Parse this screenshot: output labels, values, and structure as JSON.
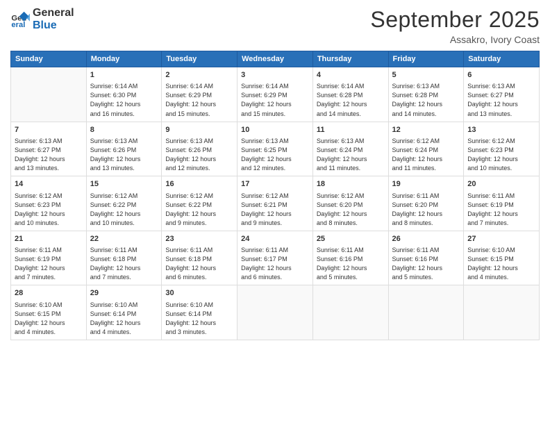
{
  "logo": {
    "line1": "General",
    "line2": "Blue"
  },
  "title": "September 2025",
  "location": "Assakro, Ivory Coast",
  "days_of_week": [
    "Sunday",
    "Monday",
    "Tuesday",
    "Wednesday",
    "Thursday",
    "Friday",
    "Saturday"
  ],
  "weeks": [
    [
      {
        "num": "",
        "info": ""
      },
      {
        "num": "1",
        "info": "Sunrise: 6:14 AM\nSunset: 6:30 PM\nDaylight: 12 hours\nand 16 minutes."
      },
      {
        "num": "2",
        "info": "Sunrise: 6:14 AM\nSunset: 6:29 PM\nDaylight: 12 hours\nand 15 minutes."
      },
      {
        "num": "3",
        "info": "Sunrise: 6:14 AM\nSunset: 6:29 PM\nDaylight: 12 hours\nand 15 minutes."
      },
      {
        "num": "4",
        "info": "Sunrise: 6:14 AM\nSunset: 6:28 PM\nDaylight: 12 hours\nand 14 minutes."
      },
      {
        "num": "5",
        "info": "Sunrise: 6:13 AM\nSunset: 6:28 PM\nDaylight: 12 hours\nand 14 minutes."
      },
      {
        "num": "6",
        "info": "Sunrise: 6:13 AM\nSunset: 6:27 PM\nDaylight: 12 hours\nand 13 minutes."
      }
    ],
    [
      {
        "num": "7",
        "info": "Sunrise: 6:13 AM\nSunset: 6:27 PM\nDaylight: 12 hours\nand 13 minutes."
      },
      {
        "num": "8",
        "info": "Sunrise: 6:13 AM\nSunset: 6:26 PM\nDaylight: 12 hours\nand 13 minutes."
      },
      {
        "num": "9",
        "info": "Sunrise: 6:13 AM\nSunset: 6:26 PM\nDaylight: 12 hours\nand 12 minutes."
      },
      {
        "num": "10",
        "info": "Sunrise: 6:13 AM\nSunset: 6:25 PM\nDaylight: 12 hours\nand 12 minutes."
      },
      {
        "num": "11",
        "info": "Sunrise: 6:13 AM\nSunset: 6:24 PM\nDaylight: 12 hours\nand 11 minutes."
      },
      {
        "num": "12",
        "info": "Sunrise: 6:12 AM\nSunset: 6:24 PM\nDaylight: 12 hours\nand 11 minutes."
      },
      {
        "num": "13",
        "info": "Sunrise: 6:12 AM\nSunset: 6:23 PM\nDaylight: 12 hours\nand 10 minutes."
      }
    ],
    [
      {
        "num": "14",
        "info": "Sunrise: 6:12 AM\nSunset: 6:23 PM\nDaylight: 12 hours\nand 10 minutes."
      },
      {
        "num": "15",
        "info": "Sunrise: 6:12 AM\nSunset: 6:22 PM\nDaylight: 12 hours\nand 10 minutes."
      },
      {
        "num": "16",
        "info": "Sunrise: 6:12 AM\nSunset: 6:22 PM\nDaylight: 12 hours\nand 9 minutes."
      },
      {
        "num": "17",
        "info": "Sunrise: 6:12 AM\nSunset: 6:21 PM\nDaylight: 12 hours\nand 9 minutes."
      },
      {
        "num": "18",
        "info": "Sunrise: 6:12 AM\nSunset: 6:20 PM\nDaylight: 12 hours\nand 8 minutes."
      },
      {
        "num": "19",
        "info": "Sunrise: 6:11 AM\nSunset: 6:20 PM\nDaylight: 12 hours\nand 8 minutes."
      },
      {
        "num": "20",
        "info": "Sunrise: 6:11 AM\nSunset: 6:19 PM\nDaylight: 12 hours\nand 7 minutes."
      }
    ],
    [
      {
        "num": "21",
        "info": "Sunrise: 6:11 AM\nSunset: 6:19 PM\nDaylight: 12 hours\nand 7 minutes."
      },
      {
        "num": "22",
        "info": "Sunrise: 6:11 AM\nSunset: 6:18 PM\nDaylight: 12 hours\nand 7 minutes."
      },
      {
        "num": "23",
        "info": "Sunrise: 6:11 AM\nSunset: 6:18 PM\nDaylight: 12 hours\nand 6 minutes."
      },
      {
        "num": "24",
        "info": "Sunrise: 6:11 AM\nSunset: 6:17 PM\nDaylight: 12 hours\nand 6 minutes."
      },
      {
        "num": "25",
        "info": "Sunrise: 6:11 AM\nSunset: 6:16 PM\nDaylight: 12 hours\nand 5 minutes."
      },
      {
        "num": "26",
        "info": "Sunrise: 6:11 AM\nSunset: 6:16 PM\nDaylight: 12 hours\nand 5 minutes."
      },
      {
        "num": "27",
        "info": "Sunrise: 6:10 AM\nSunset: 6:15 PM\nDaylight: 12 hours\nand 4 minutes."
      }
    ],
    [
      {
        "num": "28",
        "info": "Sunrise: 6:10 AM\nSunset: 6:15 PM\nDaylight: 12 hours\nand 4 minutes."
      },
      {
        "num": "29",
        "info": "Sunrise: 6:10 AM\nSunset: 6:14 PM\nDaylight: 12 hours\nand 4 minutes."
      },
      {
        "num": "30",
        "info": "Sunrise: 6:10 AM\nSunset: 6:14 PM\nDaylight: 12 hours\nand 3 minutes."
      },
      {
        "num": "",
        "info": ""
      },
      {
        "num": "",
        "info": ""
      },
      {
        "num": "",
        "info": ""
      },
      {
        "num": "",
        "info": ""
      }
    ]
  ]
}
